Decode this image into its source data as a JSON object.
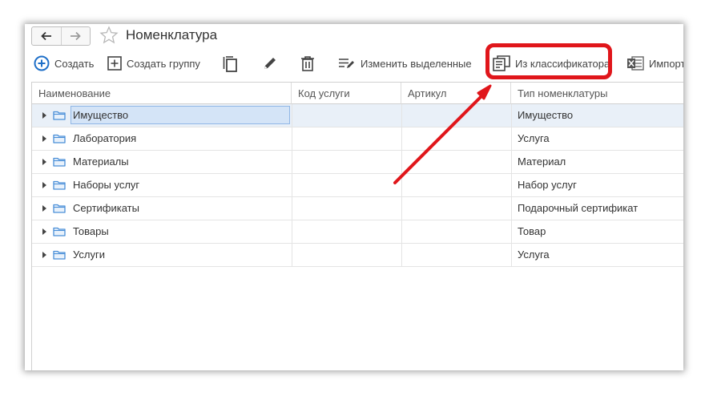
{
  "window": {
    "title": "Номенклатура"
  },
  "toolbar": {
    "create_label": "Создать",
    "create_group_label": "Создать группу",
    "edit_selected_label": "Изменить выделенные",
    "from_classifier_label": "Из классификатора",
    "import_label": "Импорт"
  },
  "table": {
    "columns": [
      "Наименование",
      "Код услуги",
      "Артикул",
      "Тип номенклатуры"
    ],
    "rows": [
      {
        "name": "Имущество",
        "code": "",
        "article": "",
        "type": "Имущество"
      },
      {
        "name": "Лаборатория",
        "code": "",
        "article": "",
        "type": "Услуга"
      },
      {
        "name": "Материалы",
        "code": "",
        "article": "",
        "type": "Материал"
      },
      {
        "name": "Наборы услуг",
        "code": "",
        "article": "",
        "type": "Набор услуг"
      },
      {
        "name": "Сертификаты",
        "code": "",
        "article": "",
        "type": "Подарочный сертификат"
      },
      {
        "name": "Товары",
        "code": "",
        "article": "",
        "type": "Товар"
      },
      {
        "name": "Услуги",
        "code": "",
        "article": "",
        "type": "Услуга"
      }
    ]
  },
  "colors": {
    "accent": "#1e6fc8",
    "highlight": "#e0161b",
    "folder": "#4a8fd8",
    "selection": "#d4e4f7"
  }
}
